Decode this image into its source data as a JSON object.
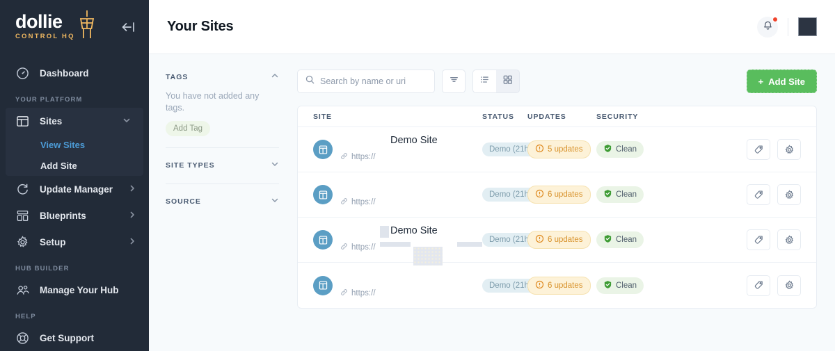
{
  "brand": {
    "name": "dollie",
    "tagline": "CONTROL HQ",
    "accent": "#f0b861",
    "sidebar_bg": "#222b38"
  },
  "sidebar": {
    "collapse_label": "Collapse sidebar",
    "items": [
      {
        "label": "Dashboard",
        "icon": "gauge-icon"
      }
    ],
    "sections": [
      {
        "title": "YOUR PLATFORM",
        "items": [
          {
            "label": "Sites",
            "icon": "layout-icon",
            "expanded": true,
            "chevron": "chevron-down-icon",
            "children": [
              {
                "label": "View Sites",
                "active": true
              },
              {
                "label": "Add Site",
                "active": false
              }
            ]
          },
          {
            "label": "Update Manager",
            "icon": "refresh-icon",
            "chevron": "chevron-right-icon"
          },
          {
            "label": "Blueprints",
            "icon": "blueprint-icon",
            "chevron": "chevron-right-icon"
          },
          {
            "label": "Setup",
            "icon": "gear-icon",
            "chevron": "chevron-right-icon"
          }
        ]
      },
      {
        "title": "HUB BUILDER",
        "items": [
          {
            "label": "Manage Your Hub",
            "icon": "users-icon"
          }
        ]
      },
      {
        "title": "HELP",
        "items": [
          {
            "label": "Get Support",
            "icon": "lifebuoy-icon"
          }
        ]
      }
    ]
  },
  "topbar": {
    "title": "Your Sites",
    "notifications_icon": "bell-icon",
    "has_unread": true,
    "unread_dot_color": "#f0432c",
    "avatar_label": "User avatar"
  },
  "filters": {
    "tags": {
      "title": "TAGS",
      "chevron": "chevron-up-icon",
      "empty_text": "You have not added any tags.",
      "add_tag_label": "Add Tag"
    },
    "site_types": {
      "title": "SITE TYPES",
      "chevron": "chevron-down-icon"
    },
    "source": {
      "title": "SOURCE",
      "chevron": "chevron-down-icon"
    }
  },
  "toolbar": {
    "search_placeholder": "Search by name or uri",
    "search_value": "",
    "search_icon": "search-icon",
    "filter_icon": "filter-icon",
    "list_view_icon": "list-view-icon",
    "grid_view_icon": "grid-view-icon",
    "active_view": "list",
    "add_site_label": "Add Site",
    "add_site_plus": "+",
    "add_site_color": "#59bd5d"
  },
  "table": {
    "columns": [
      "SITE",
      "STATUS",
      "UPDATES",
      "SECURITY"
    ],
    "rows": [
      {
        "site_icon": "website-icon",
        "name": "Demo Site",
        "url": "https://",
        "link_icon": "link-icon",
        "status": "Demo (21h)",
        "updates": "5 updates",
        "updates_icon": "alert-circle-icon",
        "security": "Clean",
        "security_icon": "shield-check-icon",
        "skeleton": false,
        "tag_action": "tag-icon",
        "settings_action": "gear-icon"
      },
      {
        "site_icon": "website-icon",
        "name": "",
        "url": "https://",
        "link_icon": "link-icon",
        "status": "Demo (21h)",
        "updates": "6 updates",
        "updates_icon": "alert-circle-icon",
        "security": "Clean",
        "security_icon": "shield-check-icon",
        "skeleton": false,
        "tag_action": "tag-icon",
        "settings_action": "gear-icon"
      },
      {
        "site_icon": "website-icon",
        "name": "Demo Site",
        "url": "https://",
        "link_icon": "link-icon",
        "status": "Demo (21h)",
        "updates": "6 updates",
        "updates_icon": "alert-circle-icon",
        "security": "Clean",
        "security_icon": "shield-check-icon",
        "skeleton": true,
        "tag_action": "tag-icon",
        "settings_action": "gear-icon"
      },
      {
        "site_icon": "website-icon",
        "name": "",
        "url": "https://",
        "link_icon": "link-icon",
        "status": "Demo (21h)",
        "updates": "6 updates",
        "updates_icon": "alert-circle-icon",
        "security": "Clean",
        "security_icon": "shield-check-icon",
        "skeleton": false,
        "tag_action": "tag-icon",
        "settings_action": "gear-icon"
      }
    ]
  },
  "colors": {
    "status_badge_bg": "#e2eef3",
    "updates_badge_bg": "#fdf2d8",
    "security_badge_bg": "#eaf4e6",
    "page_bg": "#f7fafc"
  }
}
